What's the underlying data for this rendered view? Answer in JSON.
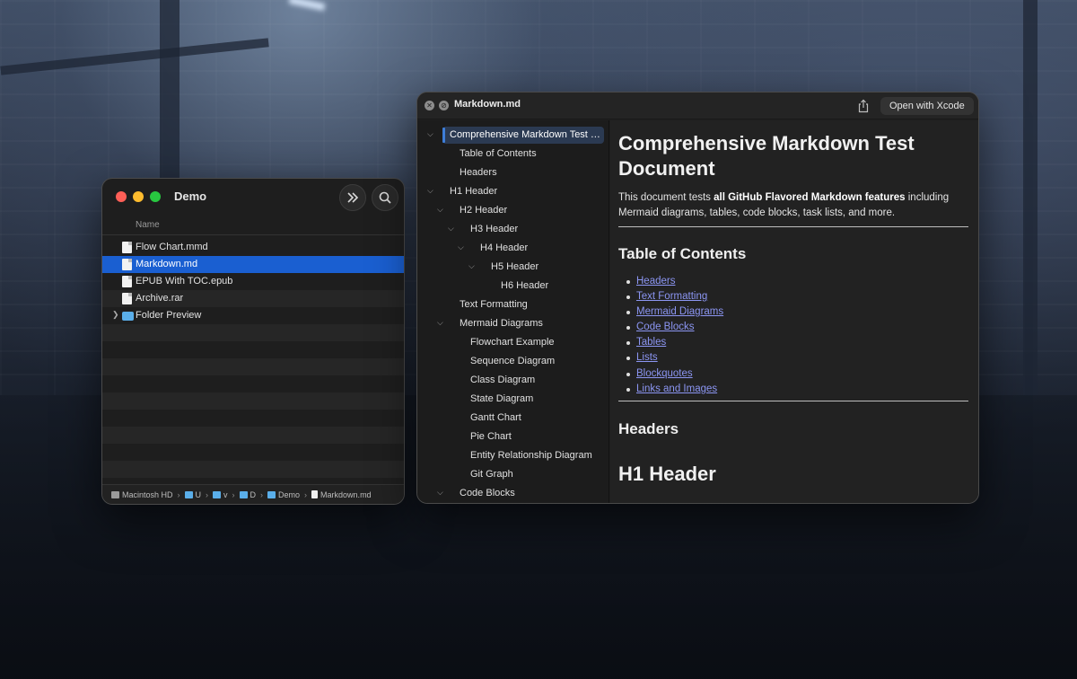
{
  "finder": {
    "title": "Demo",
    "column_name": "Name",
    "files": [
      {
        "name": "Flow Chart.mmd",
        "kind": "doc",
        "selected": false
      },
      {
        "name": "Markdown.md",
        "kind": "doc",
        "selected": true
      },
      {
        "name": "EPUB With TOC.epub",
        "kind": "doc",
        "selected": false
      },
      {
        "name": "Archive.rar",
        "kind": "doc",
        "selected": false
      },
      {
        "name": "Folder Preview",
        "kind": "folder",
        "selected": false
      }
    ],
    "pathbar": [
      "Macintosh HD",
      "U",
      "v",
      "D",
      "Demo",
      "Markdown.md"
    ],
    "icons": {
      "more": "chevrons-right-icon",
      "search": "search-icon"
    }
  },
  "markdown_window": {
    "title": "Markdown.md",
    "open_button": "Open with Xcode",
    "toc": [
      {
        "label": "Comprehensive Markdown Test Document",
        "level": 0,
        "chevron": "down",
        "active": true
      },
      {
        "label": "Table of Contents",
        "level": 1
      },
      {
        "label": "Headers",
        "level": 1
      },
      {
        "label": "H1 Header",
        "level": 0,
        "chevron": "down"
      },
      {
        "label": "H2 Header",
        "level": 1,
        "chevron": "down"
      },
      {
        "label": "H3 Header",
        "level": 2,
        "chevron": "down"
      },
      {
        "label": "H4 Header",
        "level": 3,
        "chevron": "down"
      },
      {
        "label": "H5 Header",
        "level": 4,
        "chevron": "down"
      },
      {
        "label": "H6 Header",
        "level": 5
      },
      {
        "label": "Text Formatting",
        "level": 1
      },
      {
        "label": "Mermaid Diagrams",
        "level": 1,
        "chevron": "down"
      },
      {
        "label": "Flowchart Example",
        "level": 2
      },
      {
        "label": "Sequence Diagram",
        "level": 2
      },
      {
        "label": "Class Diagram",
        "level": 2
      },
      {
        "label": "State Diagram",
        "level": 2
      },
      {
        "label": "Gantt Chart",
        "level": 2
      },
      {
        "label": "Pie Chart",
        "level": 2
      },
      {
        "label": "Entity Relationship Diagram",
        "level": 2
      },
      {
        "label": "Git Graph",
        "level": 2
      },
      {
        "label": "Code Blocks",
        "level": 1,
        "chevron": "down"
      }
    ],
    "content": {
      "title": "Comprehensive Markdown Test Document",
      "intro_prefix": "This document tests ",
      "intro_bold": "all GitHub Flavored Markdown features",
      "intro_suffix": " including Mermaid diagrams, tables, code blocks, task lists, and more.",
      "toc_heading": "Table of Contents",
      "toc_links": [
        "Headers",
        "Text Formatting",
        "Mermaid Diagrams",
        "Code Blocks",
        "Tables",
        "Lists",
        "Blockquotes",
        "Links and Images"
      ],
      "headers_heading": "Headers",
      "h1_heading": "H1 Header"
    }
  }
}
